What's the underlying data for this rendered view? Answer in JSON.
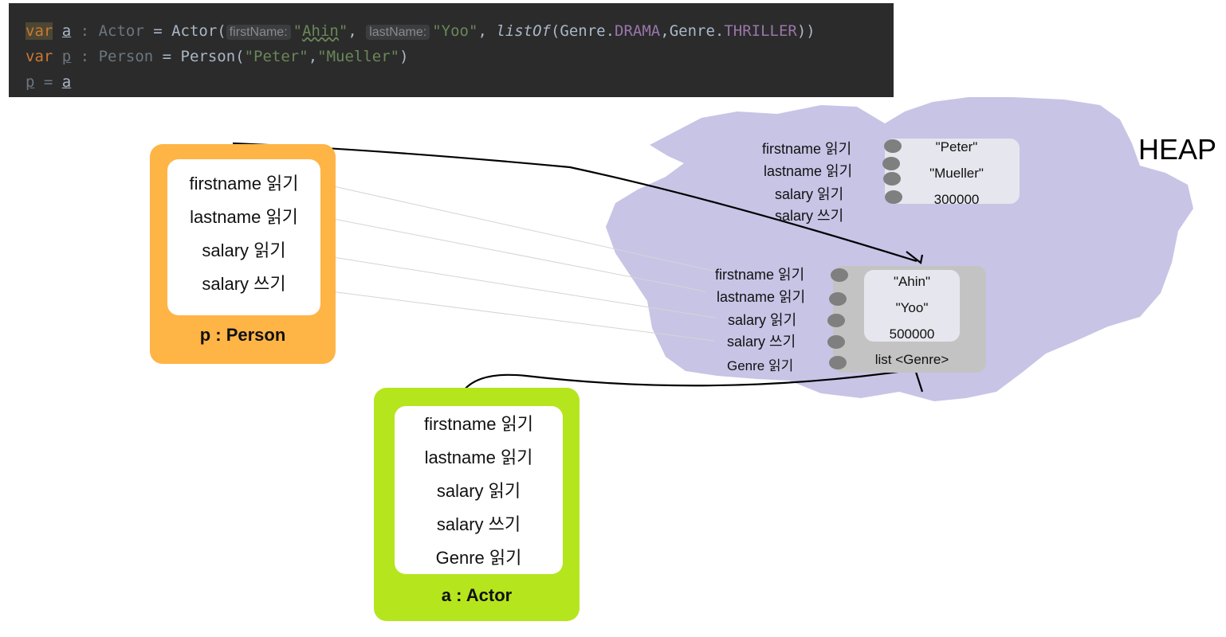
{
  "code": {
    "line1": {
      "kw": "var",
      "name": "a",
      "sep": " : ",
      "type": "Actor",
      "eq": " = ",
      "ctor": "Actor(",
      "hint1": "firstName:",
      "arg1_open": "\"",
      "arg1_text": "Ahin",
      "arg1_close": "\"",
      "comma1": ", ",
      "hint2": "lastName:",
      "arg2": "\"Yoo\"",
      "comma2": ", ",
      "fn": "listOf",
      "paren_open": "(Genre.",
      "const1": "DRAMA",
      "mid": ",Genre.",
      "const2": "THRILLER",
      "paren_close": "))"
    },
    "line2": {
      "kw": "var",
      "name": "p",
      "sep": " : ",
      "type": "Person",
      "eq": " = ",
      "ctor": "Person(",
      "arg1": "\"Peter\"",
      "comma": ",",
      "arg2": "\"Mueller\"",
      "close": ")"
    },
    "line3": {
      "lhs": "p",
      "eq": " = ",
      "rhs": "a"
    }
  },
  "person_box": {
    "rows": [
      "firstname 읽기",
      "lastname 읽기",
      "salary 읽기",
      "salary 쓰기"
    ],
    "caption": "p : Person"
  },
  "actor_box": {
    "rows": [
      "firstname 읽기",
      "lastname 읽기",
      "salary 읽기",
      "salary 쓰기",
      "Genre 읽기"
    ],
    "caption": "a : Actor"
  },
  "heap": {
    "label": "HEAP",
    "person_object": {
      "methods": [
        "firstname 읽기",
        "lastname 읽기",
        "salary 읽기",
        "salary 쓰기"
      ],
      "values": [
        "\"Peter\"",
        "\"Mueller\"",
        "300000"
      ]
    },
    "actor_object": {
      "methods": [
        "firstname 읽기",
        "lastname 읽기",
        "salary 읽기",
        "salary 쓰기",
        "Genre 읽기"
      ],
      "values": [
        "\"Ahin\"",
        "\"Yoo\"",
        "500000",
        "list <Genre>"
      ]
    }
  },
  "colors": {
    "code_bg": "#2b2b2b",
    "keyword": "#cc7832",
    "string": "#6a8759",
    "constant": "#9876aa",
    "person_box": "#ffb446",
    "actor_box": "#b5e51d",
    "heap": "#c8c4e6",
    "object_panel_light": "#e6e6ee",
    "object_panel_dark": "#c3c3c3",
    "field_dot": "#7f7f7f"
  }
}
